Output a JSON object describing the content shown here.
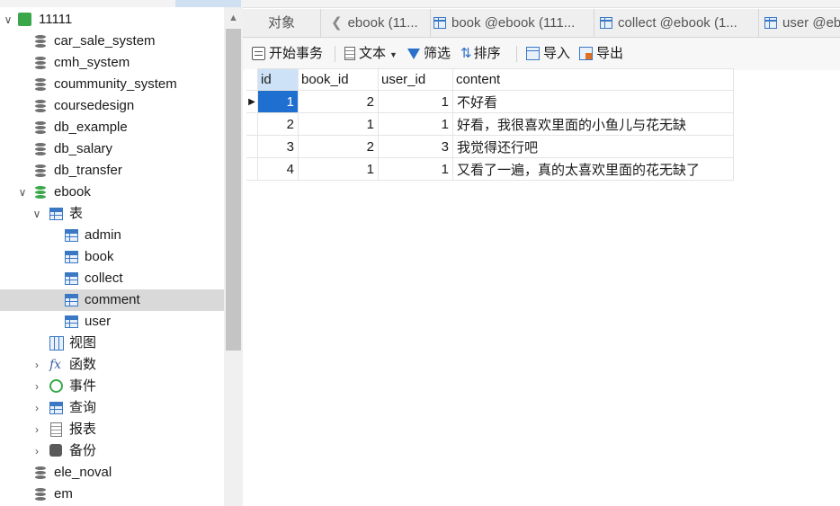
{
  "tree": {
    "connection": "11111",
    "databases_top": [
      "car_sale_system",
      "cmh_system",
      "coummunity_system",
      "coursedesign",
      "db_example",
      "db_salary",
      "db_transfer"
    ],
    "open_db": "ebook",
    "tables_group": "表",
    "tables": [
      "admin",
      "book",
      "collect",
      "comment",
      "user"
    ],
    "selected_table": "comment",
    "groups": [
      "视图",
      "函数",
      "事件",
      "查询",
      "报表",
      "备份"
    ],
    "databases_bottom": [
      "ele_noval",
      "em"
    ]
  },
  "tabs": {
    "objects": "对象",
    "t1": "ebook (11...",
    "t2": "book @ebook (111...",
    "t3": "collect @ebook (1...",
    "t4": "user @eb"
  },
  "toolbar": {
    "begin_txn": "开始事务",
    "text": "文本",
    "filter": "筛选",
    "sort": "排序",
    "import": "导入",
    "export": "导出"
  },
  "table": {
    "columns": [
      "id",
      "book_id",
      "user_id",
      "content"
    ],
    "rows": [
      [
        "1",
        "2",
        "1",
        "不好看"
      ],
      [
        "2",
        "1",
        "1",
        "好看，我很喜欢里面的小鱼儿与花无缺"
      ],
      [
        "3",
        "2",
        "3",
        "我觉得还行吧"
      ],
      [
        "4",
        "1",
        "1",
        "又看了一遍，真的太喜欢里面的花无缺了"
      ]
    ]
  },
  "colors": {
    "accent": "#1e6fd0",
    "selection": "#d9d9d9",
    "db_open": "#3aa84a"
  }
}
